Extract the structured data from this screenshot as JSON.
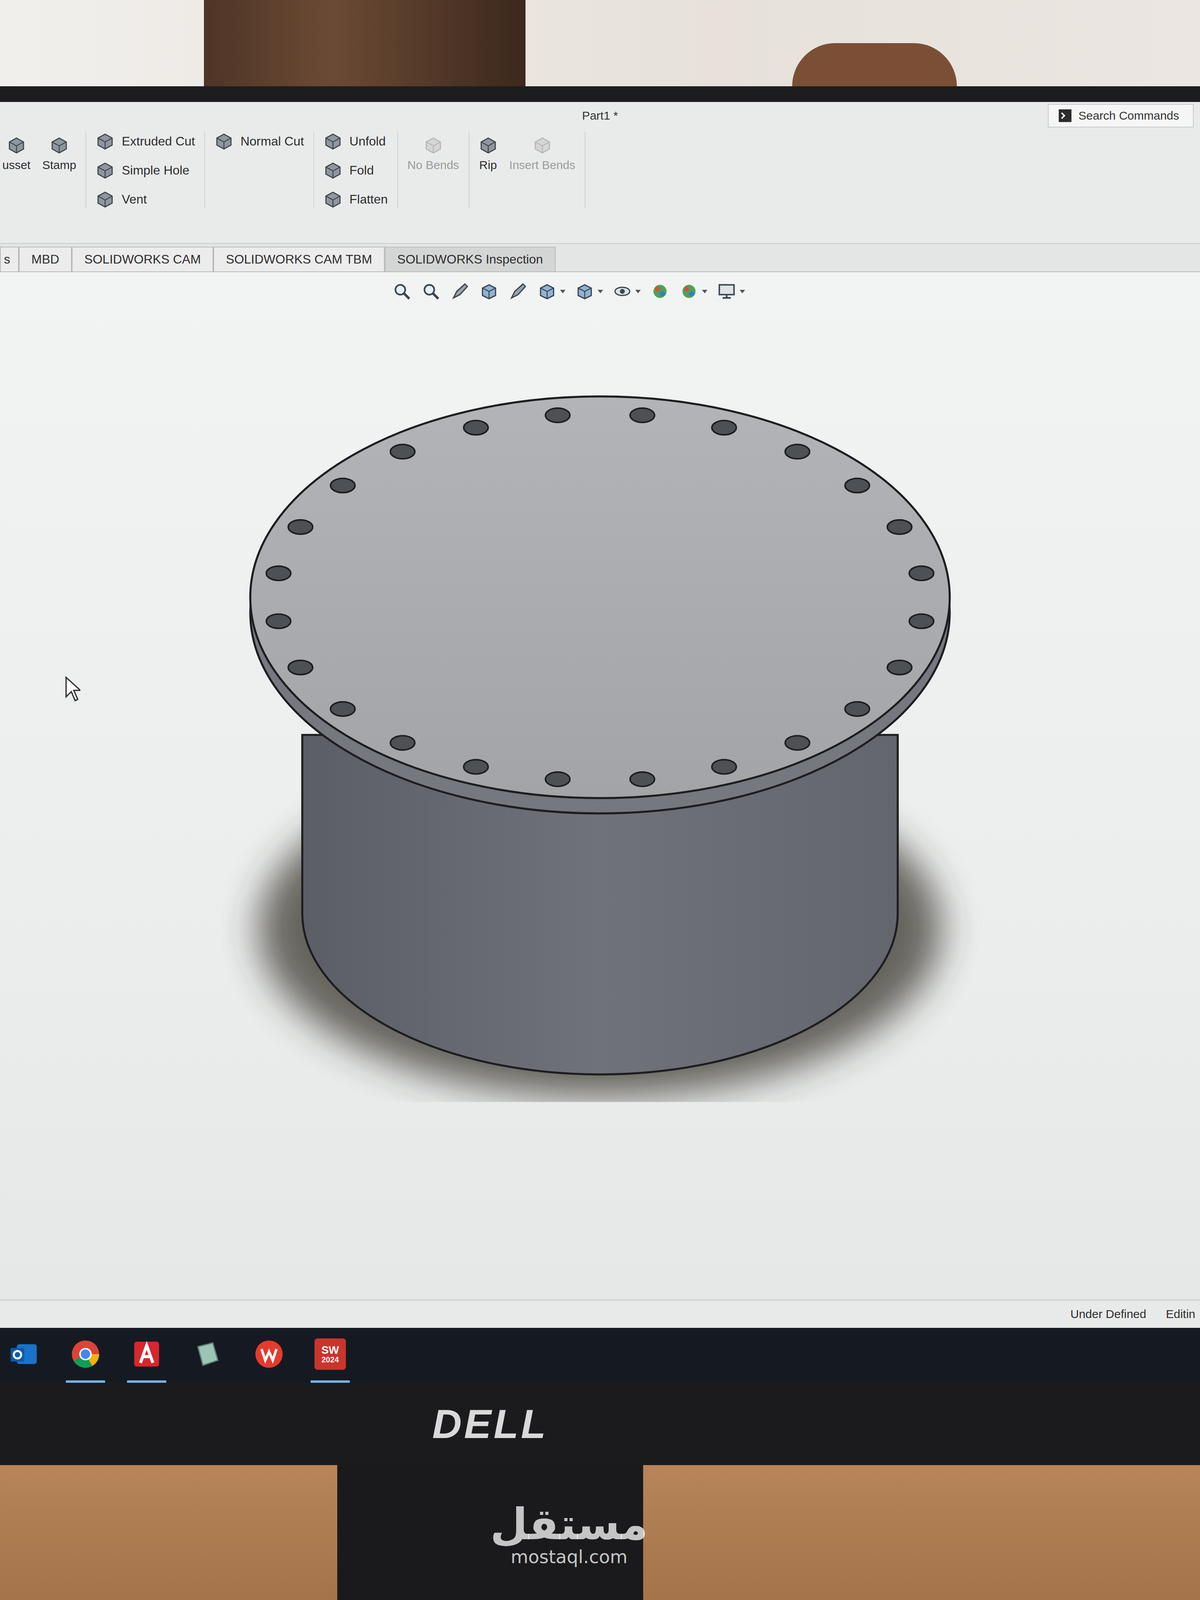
{
  "window": {
    "title": "Part1 *"
  },
  "search": {
    "placeholder": "Search Commands"
  },
  "ribbon": {
    "groups": [
      {
        "kind": "large",
        "items": [
          {
            "label": "usset",
            "disabled": false
          },
          {
            "label": "Stamp",
            "disabled": false
          }
        ]
      },
      {
        "kind": "small",
        "items": [
          {
            "label": "Extruded Cut",
            "disabled": false
          },
          {
            "label": "Simple Hole",
            "disabled": false
          },
          {
            "label": "Vent",
            "disabled": false
          }
        ]
      },
      {
        "kind": "small",
        "items": [
          {
            "label": "Normal Cut",
            "disabled": false
          }
        ]
      },
      {
        "kind": "small",
        "items": [
          {
            "label": "Unfold",
            "disabled": false
          },
          {
            "label": "Fold",
            "disabled": false
          },
          {
            "label": "Flatten",
            "disabled": false
          }
        ]
      },
      {
        "kind": "large",
        "items": [
          {
            "label": "No Bends",
            "disabled": true
          }
        ]
      },
      {
        "kind": "large",
        "items": [
          {
            "label": "Rip",
            "disabled": false
          },
          {
            "label": "Insert Bends",
            "disabled": true
          }
        ]
      }
    ]
  },
  "tabs": [
    {
      "label": "s",
      "selected": false
    },
    {
      "label": "MBD",
      "selected": false
    },
    {
      "label": "SOLIDWORKS CAM",
      "selected": false
    },
    {
      "label": "SOLIDWORKS CAM TBM",
      "selected": false
    },
    {
      "label": "SOLIDWORKS Inspection",
      "selected": true
    }
  ],
  "model": {
    "bolt_holes": 24
  },
  "status_bar": [
    "Under Defined",
    "Editin"
  ],
  "taskbar": [
    {
      "kind": "outlook",
      "active": false
    },
    {
      "kind": "chrome",
      "active": true
    },
    {
      "kind": "acrobat",
      "active": true
    },
    {
      "kind": "files",
      "active": false
    },
    {
      "kind": "wps",
      "active": false
    },
    {
      "kind": "solidworks",
      "active": true,
      "label": "SW",
      "sublabel": "2024"
    }
  ],
  "monitor": {
    "brand": "DELL"
  },
  "watermark": {
    "arabic": "مستقل",
    "latin": "mostaql.com"
  }
}
